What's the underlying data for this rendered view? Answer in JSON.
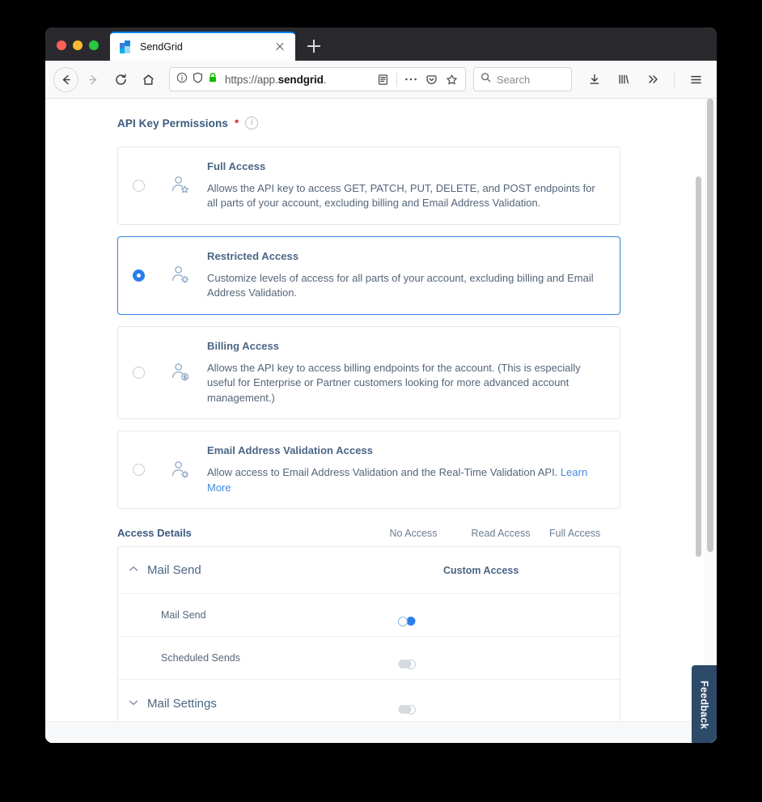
{
  "browser": {
    "tab": {
      "title": "SendGrid",
      "favicon": "sendgrid-favicon",
      "close_icon": "close-icon"
    },
    "new_tab_label": "+",
    "nav": {
      "back_icon": "back-arrow-icon",
      "forward_icon": "forward-arrow-icon",
      "reload_icon": "reload-icon",
      "home_icon": "home-icon",
      "identity_icon": "info-circle-icon",
      "shield_icon": "tracking-protection-shield-icon",
      "lock_icon": "padlock-icon",
      "url": "https://app.sendgrid.",
      "url_prefix": "https://app.",
      "url_host": "sendgrid",
      "url_suffix": ".",
      "reader_icon": "reader-view-icon",
      "more_icon": "page-actions-ellipsis-icon",
      "pocket_icon": "pocket-icon",
      "bookmark_icon": "bookmark-star-icon",
      "downloads_icon": "downloads-arrow-icon",
      "library_icon": "library-icon",
      "overflow_icon": "chevrons-right-icon",
      "menu_icon": "hamburger-menu-icon"
    },
    "search": {
      "placeholder": "Search",
      "icon": "search-icon"
    }
  },
  "page": {
    "section_title": "API Key Permissions",
    "required_marker": "•",
    "info_icon_glyph": "i",
    "permissions": [
      {
        "id": "full-access",
        "title": "Full Access",
        "description": "Allows the API key to access GET, PATCH, PUT, DELETE, and POST endpoints for all parts of your account, excluding billing and Email Address Validation.",
        "selected": false,
        "icon": "user-star-icon"
      },
      {
        "id": "restricted-access",
        "title": "Restricted Access",
        "description": "Customize levels of access for all parts of your account, excluding billing and Email Address Validation.",
        "selected": true,
        "icon": "user-gear-icon"
      },
      {
        "id": "billing-access",
        "title": "Billing Access",
        "description": "Allows the API key to access billing endpoints for the account. (This is especially useful for Enterprise or Partner customers looking for more advanced account management.)",
        "selected": false,
        "icon": "user-dollar-icon"
      },
      {
        "id": "email-validation-access",
        "title": "Email Address Validation Access",
        "description": "Allow access to Email Address Validation and the Real-Time Validation API. ",
        "link_text": "Learn More",
        "selected": false,
        "icon": "user-gear-icon"
      }
    ],
    "access_details": {
      "title": "Access Details",
      "columns": [
        "No Access",
        "Read Access",
        "Full Access"
      ],
      "groups": [
        {
          "name": "Mail Send",
          "expanded": true,
          "chevron": "chevron-up-icon",
          "status_label": "Custom Access",
          "rows": [
            {
              "name": "Mail Send",
              "value": "Full Access",
              "track": "active",
              "thumb": "right"
            },
            {
              "name": "Scheduled Sends",
              "value": "No Access",
              "track": "inactive",
              "thumb": "left"
            }
          ]
        },
        {
          "name": "Mail Settings",
          "expanded": false,
          "chevron": "chevron-down-icon",
          "status_label": "",
          "value": "No Access",
          "track": "inactive",
          "thumb": "left",
          "rows": []
        }
      ]
    },
    "feedback_label": "Feedback"
  },
  "colors": {
    "accent_blue": "#2b7de9",
    "selected_border": "#3f8ae0",
    "heading_navy": "#3b5a7f",
    "body_text": "#55657a",
    "track_grey": "#dde1e6",
    "feedback_bg": "#2d4a68",
    "required_red": "#e03e3e"
  }
}
